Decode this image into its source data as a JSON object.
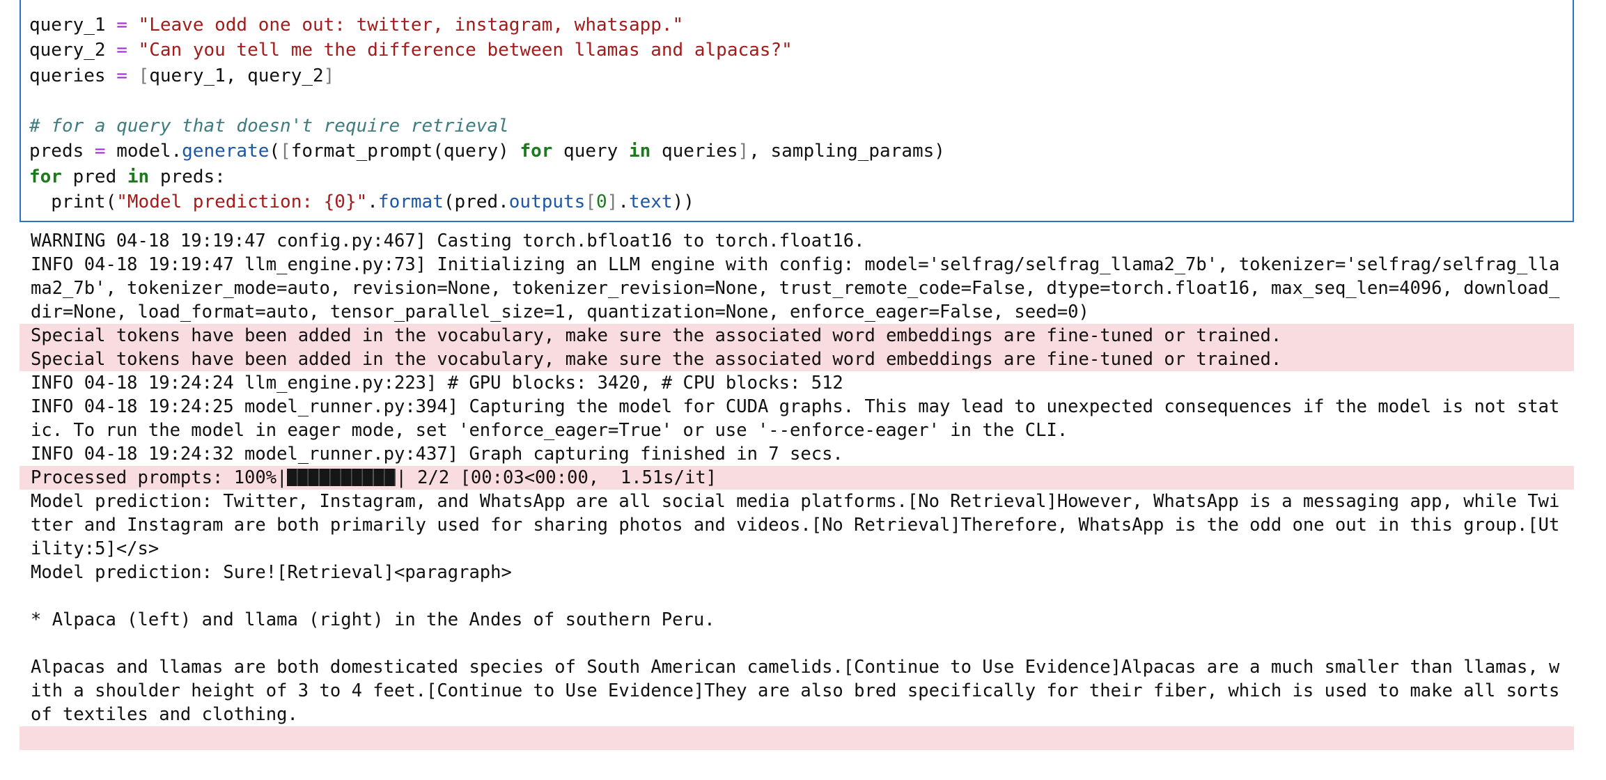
{
  "code_cell": {
    "lines": [
      [
        [
          "plain",
          "query_1 "
        ],
        [
          "op",
          "="
        ],
        [
          "plain",
          " "
        ],
        [
          "str",
          "\"Leave odd one out: twitter, instagram, whatsapp.\""
        ]
      ],
      [
        [
          "plain",
          "query_2 "
        ],
        [
          "op",
          "="
        ],
        [
          "plain",
          " "
        ],
        [
          "str",
          "\"Can you tell me the difference between llamas and alpacas?\""
        ]
      ],
      [
        [
          "plain",
          "queries "
        ],
        [
          "op",
          "="
        ],
        [
          "plain",
          " "
        ],
        [
          "brk",
          "["
        ],
        [
          "plain",
          "query_1, query_2"
        ],
        [
          "brk",
          "]"
        ]
      ],
      [],
      [
        [
          "com",
          "# for a query that doesn't require retrieval"
        ]
      ],
      [
        [
          "plain",
          "preds "
        ],
        [
          "op",
          "="
        ],
        [
          "plain",
          " model."
        ],
        [
          "fn",
          "generate"
        ],
        [
          "plain",
          "("
        ],
        [
          "brk",
          "["
        ],
        [
          "plain",
          "format_prompt(query) "
        ],
        [
          "kw",
          "for"
        ],
        [
          "plain",
          " query "
        ],
        [
          "kw",
          "in"
        ],
        [
          "plain",
          " queries"
        ],
        [
          "brk",
          "]"
        ],
        [
          "plain",
          ", sampling_params)"
        ]
      ],
      [
        [
          "kw",
          "for"
        ],
        [
          "plain",
          " pred "
        ],
        [
          "kw",
          "in"
        ],
        [
          "plain",
          " preds:"
        ]
      ],
      [
        [
          "plain",
          "  print("
        ],
        [
          "str",
          "\"Model prediction: {0}\""
        ],
        [
          "plain",
          "."
        ],
        [
          "fn",
          "format"
        ],
        [
          "plain",
          "(pred."
        ],
        [
          "attr",
          "outputs"
        ],
        [
          "brk",
          "["
        ],
        [
          "num",
          "0"
        ],
        [
          "brk",
          "]"
        ],
        [
          "plain",
          "."
        ],
        [
          "attr",
          "text"
        ],
        [
          "plain",
          "))"
        ]
      ]
    ]
  },
  "output": {
    "blocks": [
      {
        "stream": "stdout",
        "lines": [
          "WARNING 04-18 19:19:47 config.py:467] Casting torch.bfloat16 to torch.float16.",
          "INFO 04-18 19:19:47 llm_engine.py:73] Initializing an LLM engine with config: model='selfrag/selfrag_llama2_7b', tokenizer='selfrag/selfrag_llama2_7b', tokenizer_mode=auto, revision=None, tokenizer_revision=None, trust_remote_code=False, dtype=torch.float16, max_seq_len=4096, download_dir=None, load_format=auto, tensor_parallel_size=1, quantization=None, enforce_eager=False, seed=0)"
        ]
      },
      {
        "stream": "stderr",
        "lines": [
          "Special tokens have been added in the vocabulary, make sure the associated word embeddings are fine-tuned or trained.",
          "Special tokens have been added in the vocabulary, make sure the associated word embeddings are fine-tuned or trained."
        ]
      },
      {
        "stream": "stdout",
        "lines": [
          "INFO 04-18 19:24:24 llm_engine.py:223] # GPU blocks: 3420, # CPU blocks: 512",
          "INFO 04-18 19:24:25 model_runner.py:394] Capturing the model for CUDA graphs. This may lead to unexpected consequences if the model is not static. To run the model in eager mode, set 'enforce_eager=True' or use '--enforce-eager' in the CLI.",
          "INFO 04-18 19:24:32 model_runner.py:437] Graph capturing finished in 7 secs."
        ]
      },
      {
        "stream": "stderr",
        "progress": {
          "prefix": "Processed prompts: 100%|",
          "fraction": 1.0,
          "suffix": "| 2/2 [00:03<00:00,  1.51s/it]"
        }
      },
      {
        "stream": "stdout",
        "lines": [
          "Model prediction: Twitter, Instagram, and WhatsApp are all social media platforms.[No Retrieval]However, WhatsApp is a messaging app, while Twitter and Instagram are both primarily used for sharing photos and videos.[No Retrieval]Therefore, WhatsApp is the odd one out in this group.[Utility:5]</s>",
          "Model prediction: Sure![Retrieval]<paragraph>",
          "",
          "* Alpaca (left) and llama (right) in the Andes of southern Peru.",
          "",
          "Alpacas and llamas are both domesticated species of South American camelids.[Continue to Use Evidence]Alpacas are a much smaller than llamas, with a shoulder height of 3 to 4 feet.[Continue to Use Evidence]They are also bred specifically for their fiber, which is used to make all sorts of textiles and clothing."
        ]
      },
      {
        "stream": "stderr",
        "lines": [
          ""
        ]
      }
    ]
  },
  "colors": {
    "cell_border": "#2f73c9",
    "stderr_bg": "#f8dcdf",
    "string": "#a41b1b",
    "operator": "#a629d6",
    "keyword": "#1b7a1b",
    "comment": "#3e7c80",
    "function": "#1d56a6"
  }
}
